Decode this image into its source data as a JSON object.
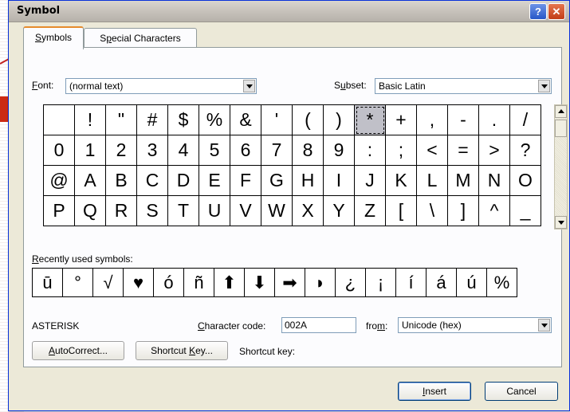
{
  "window": {
    "title": "Symbol",
    "help_glyph": "?",
    "close_glyph": "✕"
  },
  "tabs": [
    {
      "label": "Symbols",
      "accel": "S",
      "rest": "ymbols"
    },
    {
      "label": "Special Characters",
      "pre": "S",
      "accel": "p",
      "rest": "ecial Characters"
    }
  ],
  "font": {
    "label_pre": "",
    "accel": "F",
    "label_rest": "ont:",
    "value": "(normal text)"
  },
  "subset": {
    "label_pre": "S",
    "accel": "u",
    "label_rest": "bset:",
    "value": "Basic Latin"
  },
  "symbols": [
    [
      " ",
      "!",
      "\"",
      "#",
      "$",
      "%",
      "&",
      "'",
      "(",
      ")",
      "*",
      "+",
      ",",
      "-",
      ".",
      "/"
    ],
    [
      "0",
      "1",
      "2",
      "3",
      "4",
      "5",
      "6",
      "7",
      "8",
      "9",
      ":",
      ";",
      "<",
      "=",
      ">",
      "?"
    ],
    [
      "@",
      "A",
      "B",
      "C",
      "D",
      "E",
      "F",
      "G",
      "H",
      "I",
      "J",
      "K",
      "L",
      "M",
      "N",
      "O"
    ],
    [
      "P",
      "Q",
      "R",
      "S",
      "T",
      "U",
      "V",
      "W",
      "X",
      "Y",
      "Z",
      "[",
      "\\",
      "]",
      "^",
      "_"
    ]
  ],
  "selected_symbol": "*",
  "recent": {
    "label_pre": "",
    "accel": "R",
    "label_rest": "ecently used symbols:",
    "items": [
      "ū",
      "°",
      "√",
      "♥",
      "ó",
      "ñ",
      "⬆",
      "⬇",
      "➡",
      "◗",
      "¿",
      "¡",
      "í",
      "á",
      "ú",
      "%"
    ]
  },
  "char_name": "ASTERISK",
  "char_code": {
    "label_pre": "",
    "accel": "C",
    "label_rest": "haracter code:",
    "value": "002A"
  },
  "from": {
    "label_pre": "fro",
    "accel": "m",
    "label_rest": ":",
    "value": "Unicode (hex)"
  },
  "buttons": {
    "autocorrect": {
      "pre": "",
      "accel": "A",
      "rest": "utoCorrect..."
    },
    "shortcut_key": {
      "pre": "Shortcut ",
      "accel": "K",
      "rest": "ey..."
    },
    "insert": {
      "pre": "",
      "accel": "I",
      "rest": "nsert"
    },
    "cancel": "Cancel"
  },
  "shortcut_key_label": "Shortcut key:"
}
